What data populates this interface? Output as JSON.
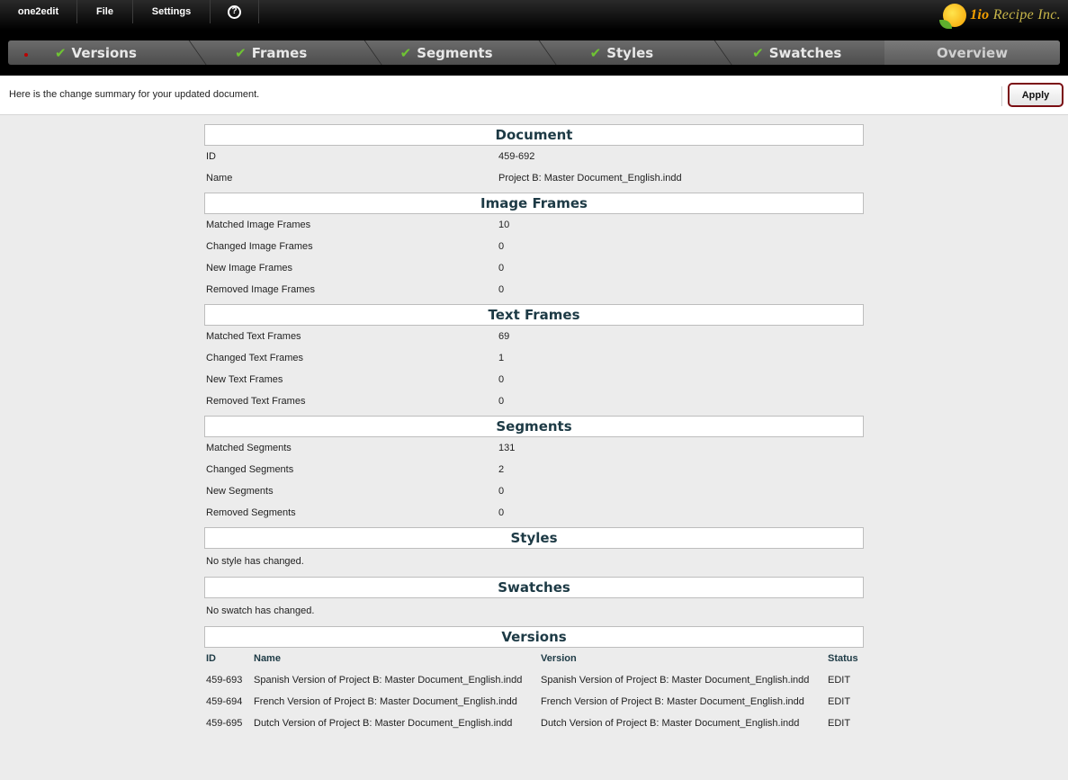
{
  "menu": {
    "app": "one2edit",
    "file": "File",
    "settings": "Settings",
    "help": "?"
  },
  "logo": {
    "prefix": "1io",
    "name": "Recipe Inc."
  },
  "steps": [
    {
      "label": "Versions",
      "done": true
    },
    {
      "label": "Frames",
      "done": true
    },
    {
      "label": "Segments",
      "done": true
    },
    {
      "label": "Styles",
      "done": true
    },
    {
      "label": "Swatches",
      "done": true
    },
    {
      "label": "Overview",
      "done": false
    }
  ],
  "infobar": {
    "text": "Here is the change summary for your updated document.",
    "apply_label": "Apply"
  },
  "document": {
    "title": "Document",
    "rows": [
      {
        "k": "ID",
        "v": "459-692"
      },
      {
        "k": "Name",
        "v": "Project B: Master Document_English.indd"
      }
    ]
  },
  "image_frames": {
    "title": "Image Frames",
    "rows": [
      {
        "k": "Matched Image Frames",
        "v": "10"
      },
      {
        "k": "Changed Image Frames",
        "v": "0"
      },
      {
        "k": "New Image Frames",
        "v": "0"
      },
      {
        "k": "Removed Image Frames",
        "v": "0"
      }
    ]
  },
  "text_frames": {
    "title": "Text Frames",
    "rows": [
      {
        "k": "Matched Text Frames",
        "v": "69"
      },
      {
        "k": "Changed Text Frames",
        "v": "1"
      },
      {
        "k": "New Text Frames",
        "v": "0"
      },
      {
        "k": "Removed Text Frames",
        "v": "0"
      }
    ]
  },
  "segments": {
    "title": "Segments",
    "rows": [
      {
        "k": "Matched Segments",
        "v": "131"
      },
      {
        "k": "Changed Segments",
        "v": "2"
      },
      {
        "k": "New Segments",
        "v": "0"
      },
      {
        "k": "Removed Segments",
        "v": "0"
      }
    ]
  },
  "styles": {
    "title": "Styles",
    "message": "No style has changed."
  },
  "swatches": {
    "title": "Swatches",
    "message": "No swatch has changed."
  },
  "versions": {
    "title": "Versions",
    "headers": {
      "id": "ID",
      "name": "Name",
      "version": "Version",
      "status": "Status"
    },
    "rows": [
      {
        "id": "459-693",
        "name": "Spanish Version of Project B: Master Document_English.indd",
        "version": "Spanish Version of Project B: Master Document_English.indd",
        "status": "EDIT"
      },
      {
        "id": "459-694",
        "name": "French Version of Project B: Master Document_English.indd",
        "version": "French Version of Project B: Master Document_English.indd",
        "status": "EDIT"
      },
      {
        "id": "459-695",
        "name": "Dutch Version of Project B: Master Document_English.indd",
        "version": "Dutch Version of Project B: Master Document_English.indd",
        "status": "EDIT"
      }
    ]
  }
}
